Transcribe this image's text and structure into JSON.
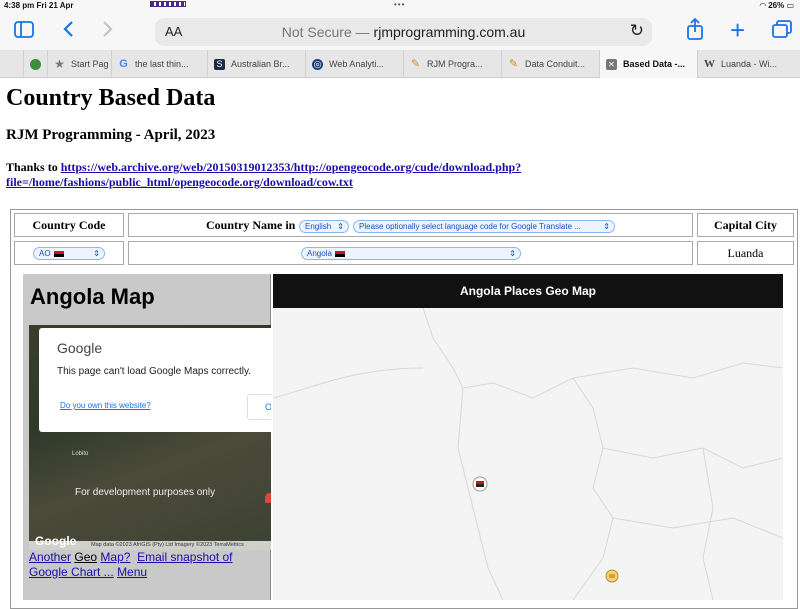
{
  "status": {
    "time": "4:38 pm  Fri 21 Apr",
    "battery": "26%"
  },
  "browser": {
    "aa_label": "AA",
    "not_secure": "Not Secure —",
    "domain": "rjmprogramming.com.au",
    "tabs": [
      {
        "label": "",
        "icon": "leaf-icon",
        "color": "#3c8d3c"
      },
      {
        "label": "Start Pag",
        "icon": "star-icon",
        "color": "#777777"
      },
      {
        "label": "the last thin...",
        "icon": "google-icon",
        "color": "#4285f4"
      },
      {
        "label": "Australian Br...",
        "icon": "s-icon",
        "color": "#1e2a4a"
      },
      {
        "label": "Web Analyti...",
        "icon": "analytics-icon",
        "color": "#1f3d7a"
      },
      {
        "label": "RJM Progra...",
        "icon": "pencil-icon",
        "color": "#d08a2a"
      },
      {
        "label": "Data Conduit...",
        "icon": "pencil-icon",
        "color": "#d08a2a"
      },
      {
        "label": "Based Data -...",
        "icon": "page-icon",
        "color": "#777777",
        "active": true
      },
      {
        "label": "Luanda - Wi...",
        "icon": "wikipedia-icon",
        "color": "#444444"
      }
    ]
  },
  "page": {
    "title": "Country Based Data",
    "subtitle": "RJM Programming - April, 2023",
    "thanks_prefix": "Thanks to ",
    "thanks_link": "https://web.archive.org/web/20150319012353/http://opengeocode.org/cude/download.php?file=/home/fashions/public_html/opengeocode.org/download/cow.txt"
  },
  "table": {
    "col_country_code": "Country Code",
    "col_country_name": "Country Name in",
    "col_capital": "Capital City",
    "language_select": "English",
    "translate_select": "Please optionally select language code for Google Translate ...",
    "code_select": "AO",
    "name_select": "Angola",
    "capital_value": "Luanda"
  },
  "left_map": {
    "heading": "Angola Map",
    "dialog_brand": "Google",
    "dialog_message": "This page can't load Google Maps correctly.",
    "dialog_link": "Do you own this website?",
    "dialog_button": "OK",
    "dev_text": "For development purposes only",
    "place_label": "Lobito",
    "map_brand": "Google",
    "map_data": "Map data ©2023 AfriGIS (Pty) Ltd Imagery ©2023 TerraMetrics",
    "link_another": "Another",
    "link_geo": "Geo",
    "link_map": "Map?",
    "link_email": "Email snapshot of Google Chart ...",
    "link_menu": "Menu"
  },
  "geo_map": {
    "heading": "Angola Places Geo Map",
    "background": "#f4f4f4",
    "border_color": "#d8d8d8",
    "markers": [
      {
        "name": "luanda-marker-icon",
        "color": "#d0121b"
      },
      {
        "name": "place-marker-icon",
        "color": "#d9a22b"
      }
    ]
  }
}
